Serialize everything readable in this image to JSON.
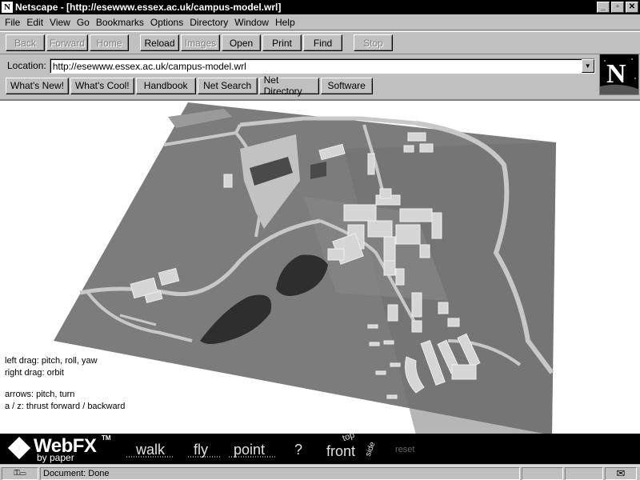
{
  "window": {
    "title": "Netscape - [http://esewww.essex.ac.uk/campus-model.wrl]",
    "app_icon": "netscape-n-icon",
    "controls": {
      "minimize": "_",
      "maximize": "▫",
      "close": "✕"
    }
  },
  "menu": [
    "File",
    "Edit",
    "View",
    "Go",
    "Bookmarks",
    "Options",
    "Directory",
    "Window",
    "Help"
  ],
  "toolbar": {
    "back": "Back",
    "forward": "Forward",
    "home": "Home",
    "reload": "Reload",
    "images": "Images",
    "open": "Open",
    "print": "Print",
    "find": "Find",
    "stop": "Stop"
  },
  "location": {
    "label": "Location:",
    "url": "http://esewww.essex.ac.uk/campus-model.wrl"
  },
  "directory_buttons": [
    "What's New!",
    "What's Cool!",
    "Handbook",
    "Net Search",
    "Net Directory",
    "Software"
  ],
  "logo": {
    "letter": "N"
  },
  "help_text": {
    "line1": "left drag: pitch, roll, yaw",
    "line2": "right drag: orbit",
    "line3": "arrows: pitch, turn",
    "line4": "a / z: thrust forward / backward"
  },
  "webfx": {
    "logo": "WebFX",
    "tm": "TM",
    "by": "by paper",
    "walk": "walk",
    "fly": "fly",
    "point": "point",
    "help": "?",
    "front": "front",
    "top": "top",
    "side": "side",
    "reset": "reset"
  },
  "status": {
    "text": "Document: Done",
    "mail_icon": "mail-icon"
  },
  "colors": {
    "ground": "#7c7c7c",
    "roads": "#c8c8c8",
    "buildings": "#d6d6d6",
    "water": "#2e2e2e"
  }
}
